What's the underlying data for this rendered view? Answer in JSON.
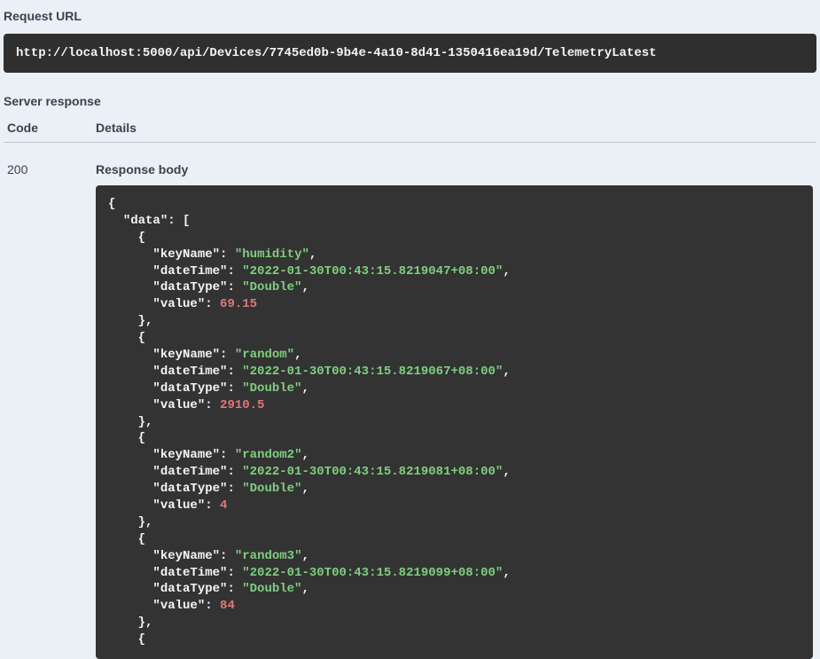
{
  "section_request_url_label": "Request URL",
  "request_url_value": "http://localhost:5000/api/Devices/7745ed0b-9b4e-4a10-8d41-1350416ea19d/TelemetryLatest",
  "section_server_response_label": "Server response",
  "headers": {
    "code": "Code",
    "details": "Details"
  },
  "response": {
    "code": "200",
    "body_label": "Response body",
    "json": {
      "data": [
        {
          "keyName": "humidity",
          "dateTime": "2022-01-30T00:43:15.8219047+08:00",
          "dataType": "Double",
          "value": 69.15
        },
        {
          "keyName": "random",
          "dateTime": "2022-01-30T00:43:15.8219067+08:00",
          "dataType": "Double",
          "value": 2910.5
        },
        {
          "keyName": "random2",
          "dateTime": "2022-01-30T00:43:15.8219081+08:00",
          "dataType": "Double",
          "value": 4
        },
        {
          "keyName": "random3",
          "dateTime": "2022-01-30T00:43:15.8219099+08:00",
          "dataType": "Double",
          "value": 84
        }
      ]
    }
  }
}
